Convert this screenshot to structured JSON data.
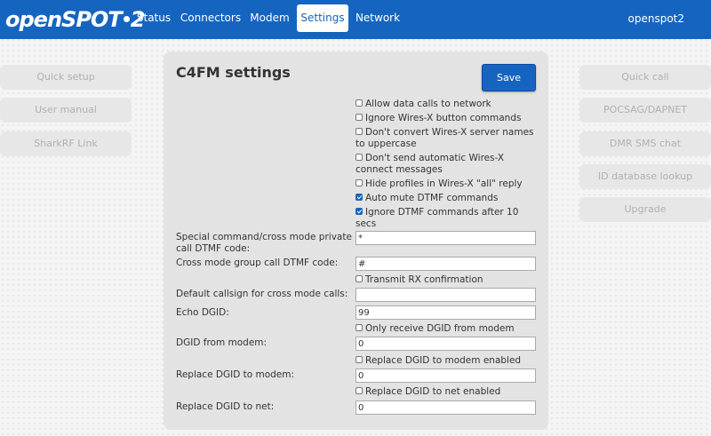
{
  "header": {
    "logo_text": "openSPOT",
    "logo_suffix": "2",
    "device_name": "openspot2",
    "tabs": [
      {
        "label": "Status",
        "active": false
      },
      {
        "label": "Connectors",
        "active": false
      },
      {
        "label": "Modem",
        "active": false
      },
      {
        "label": "Settings",
        "active": true
      },
      {
        "label": "Network",
        "active": false
      }
    ]
  },
  "left_buttons": [
    "Quick setup",
    "User manual",
    "SharkRF Link"
  ],
  "right_buttons": [
    "Quick call",
    "POCSAG/DAPNET",
    "DMR SMS chat",
    "ID database lookup",
    "Upgrade"
  ],
  "panel": {
    "title": "C4FM settings",
    "save_label": "Save",
    "checkboxes": [
      {
        "label": "Allow data calls to network",
        "checked": false
      },
      {
        "label": "Ignore Wires-X button commands",
        "checked": false
      },
      {
        "label": "Don't convert Wires-X server names to uppercase",
        "checked": false
      },
      {
        "label": "Don't send automatic Wires-X connect messages",
        "checked": false
      },
      {
        "label": "Hide profiles in Wires-X \"all\" reply",
        "checked": false
      },
      {
        "label": "Auto mute DTMF commands",
        "checked": true
      },
      {
        "label": "Ignore DTMF commands after 10 secs",
        "checked": true
      }
    ],
    "fields": {
      "private_dtmf": {
        "label": "Special command/cross mode private call DTMF code:",
        "value": "*"
      },
      "group_dtmf": {
        "label": "Cross mode group call DTMF code:",
        "value": "#"
      },
      "transmit_rx": {
        "label": "Transmit RX confirmation",
        "checked": false
      },
      "default_callsign": {
        "label": "Default callsign for cross mode calls:",
        "value": ""
      },
      "echo_dgid": {
        "label": "Echo DGID:",
        "value": "99"
      },
      "only_receive_dgid": {
        "label": "Only receive DGID from modem",
        "checked": false
      },
      "dgid_from_modem": {
        "label": "DGID from modem:",
        "value": "0"
      },
      "replace_dgid_modem_enabled": {
        "label": "Replace DGID to modem enabled",
        "checked": false
      },
      "replace_dgid_modem": {
        "label": "Replace DGID to modem:",
        "value": "0"
      },
      "replace_dgid_net_enabled": {
        "label": "Replace DGID to net enabled",
        "checked": false
      },
      "replace_dgid_net": {
        "label": "Replace DGID to net:",
        "value": "0"
      }
    }
  }
}
